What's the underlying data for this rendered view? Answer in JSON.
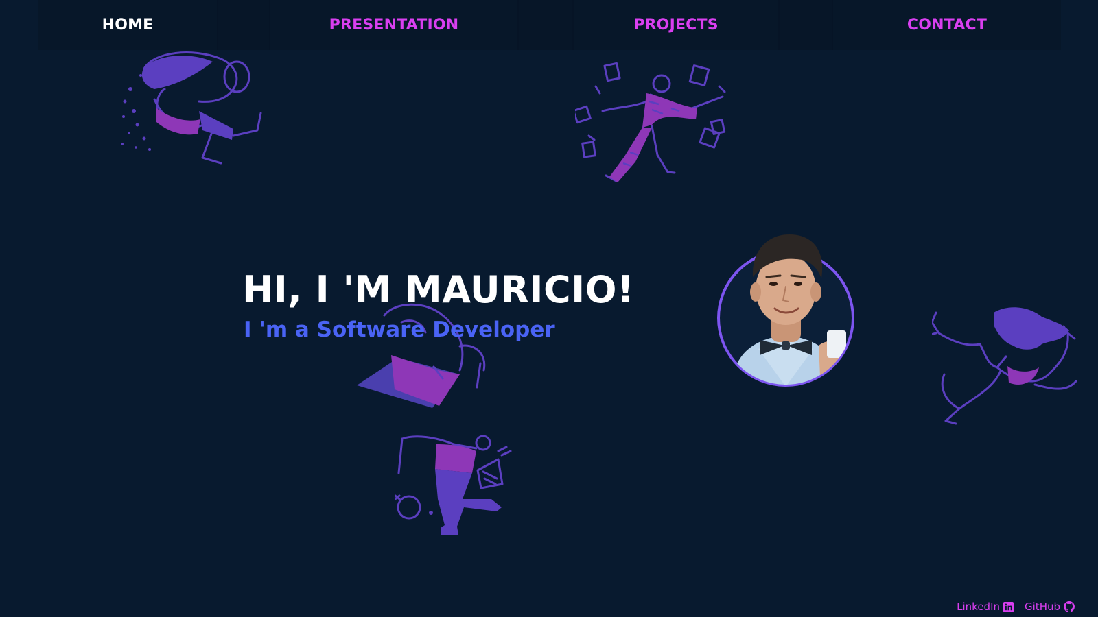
{
  "theme": {
    "background": "#081a2f",
    "accent_magenta": "#d93ff0",
    "accent_blue": "#4a63f5",
    "illustration_purple": "#5b3fc0",
    "illustration_magenta": "#8e37b7",
    "avatar_ring": "#7d55f0"
  },
  "nav": {
    "items": [
      {
        "label": "HOME",
        "active": true
      },
      {
        "label": "PRESENTATION",
        "active": false
      },
      {
        "label": "PROJECTS",
        "active": false
      },
      {
        "label": "CONTACT",
        "active": false
      }
    ]
  },
  "hero": {
    "title": "HI, I 'M MAURICIO!",
    "subtitle": "I 'm a Software Developer"
  },
  "footer": {
    "links": [
      {
        "label": "LinkedIn",
        "icon": "linkedin-icon"
      },
      {
        "label": "GitHub",
        "icon": "github-icon"
      }
    ]
  }
}
